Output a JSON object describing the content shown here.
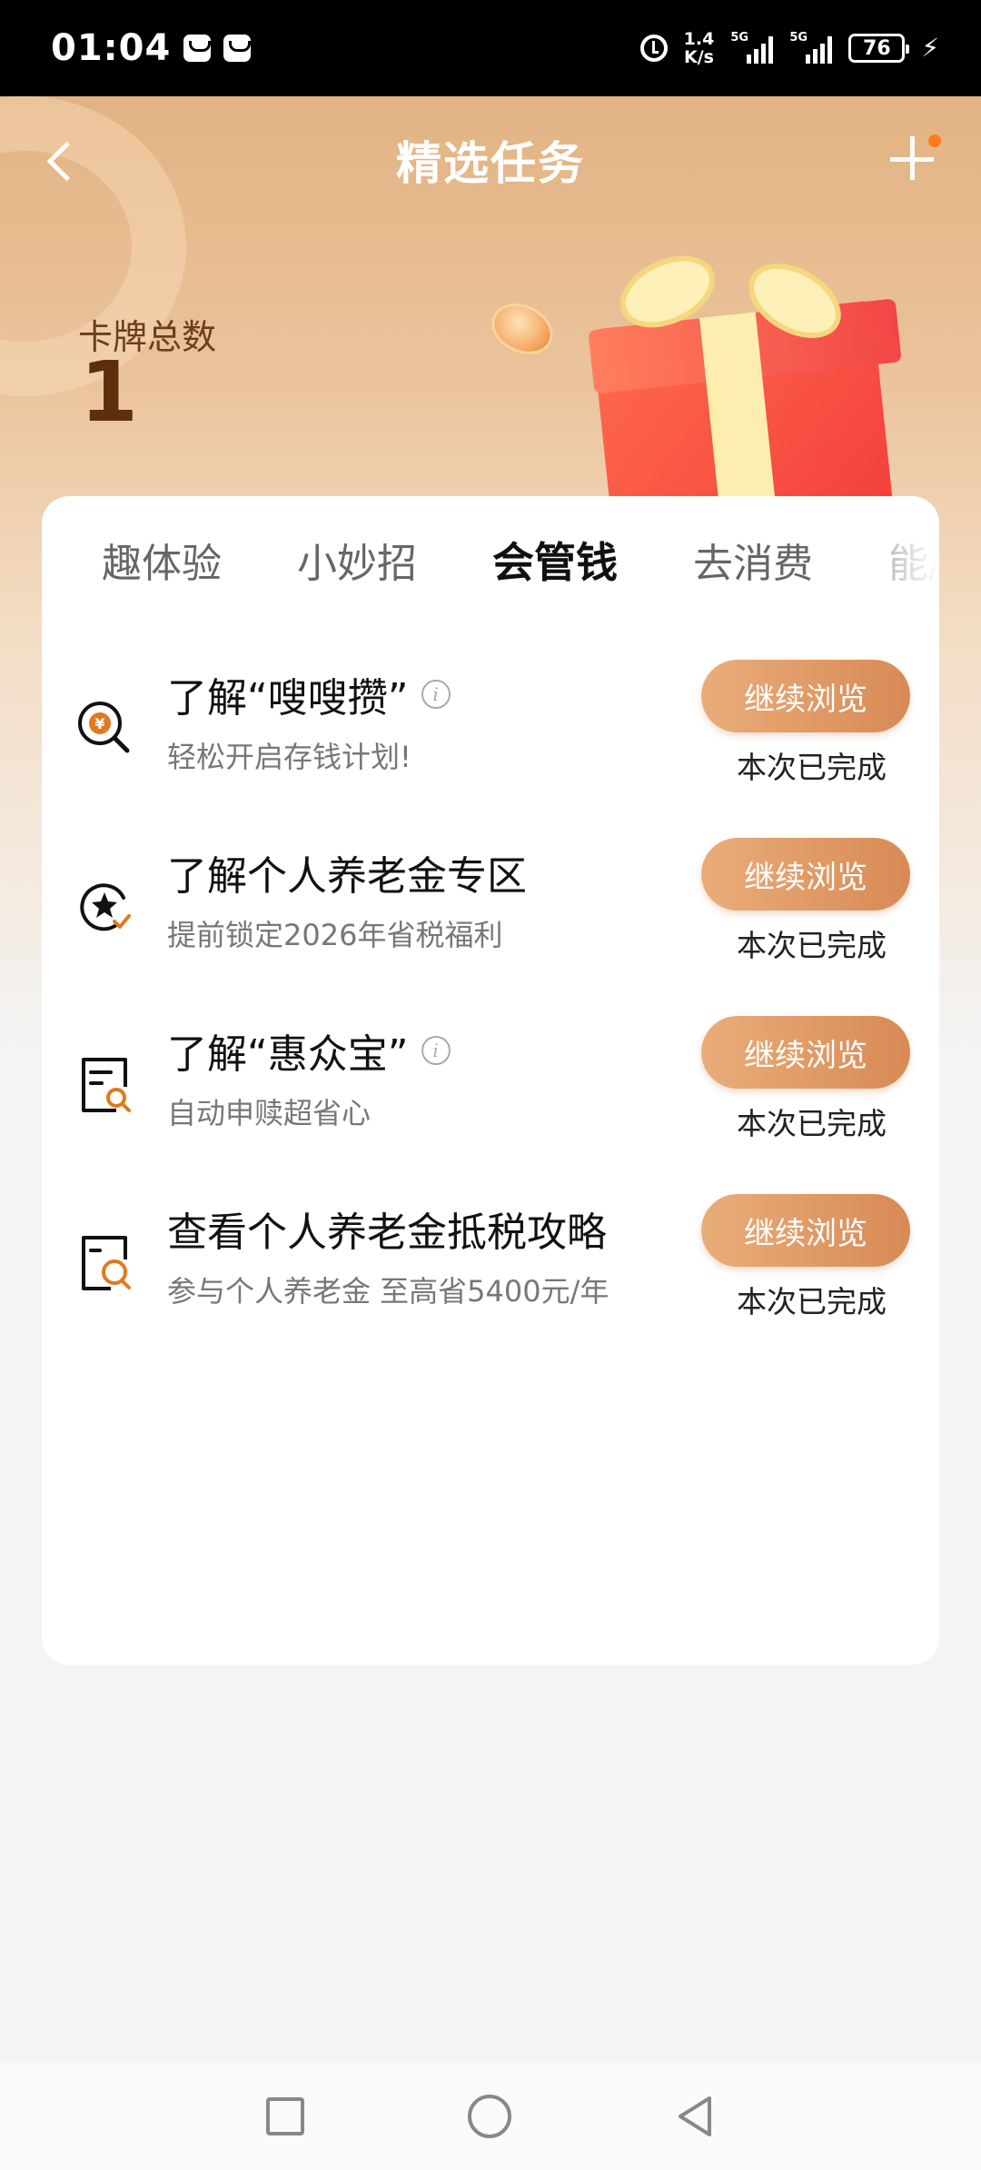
{
  "status_bar": {
    "time": "01:04",
    "net_speed_value": "1.4",
    "net_speed_unit": "K/s",
    "signal_1_label": "5G",
    "signal_2_label": "5G",
    "battery": "76"
  },
  "header": {
    "title": "精选任务",
    "card_total_label": "卡牌总数",
    "card_total_value": "1"
  },
  "tabs": [
    {
      "label": "趣体验",
      "active": false
    },
    {
      "label": "小妙招",
      "active": false
    },
    {
      "label": "会管钱",
      "active": true
    },
    {
      "label": "去消费",
      "active": false
    },
    {
      "label": "能/",
      "active": false
    }
  ],
  "tasks": [
    {
      "icon": "yuan-search-icon",
      "title": "了解“嗖嗖攒”",
      "has_info": true,
      "subtitle": "轻松开启存钱计划!",
      "button": "继续浏览",
      "status": "本次已完成"
    },
    {
      "icon": "star-check-icon",
      "title": "了解个人养老金专区",
      "has_info": false,
      "subtitle": "提前锁定2026年省税福利",
      "button": "继续浏览",
      "status": "本次已完成"
    },
    {
      "icon": "document-search-icon",
      "title": "了解“惠众宝”",
      "has_info": true,
      "subtitle": "自动申赎超省心",
      "button": "继续浏览",
      "status": "本次已完成"
    },
    {
      "icon": "document-search-icon",
      "title": "查看个人养老金抵税攻略",
      "has_info": false,
      "subtitle": "参与个人养老金 至高省5400元/年",
      "button": "继续浏览",
      "status": "本次已完成"
    }
  ],
  "colors": {
    "accent": "#e07a1f",
    "button_start": "#e9ad7a",
    "button_end": "#d88a55",
    "header_top": "#e2b383"
  }
}
